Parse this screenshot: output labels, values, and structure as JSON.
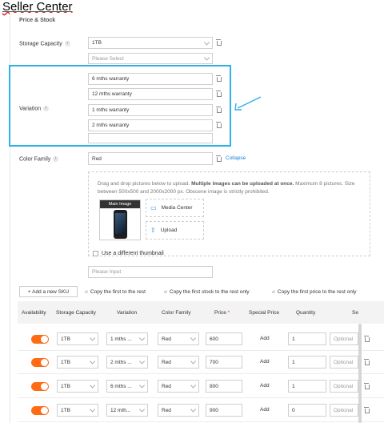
{
  "page_title": "Seller Center",
  "section_title": "Price & Stock",
  "storage_capacity": {
    "label": "Storage Capacity",
    "value": "1TB",
    "placeholder": "Please Select"
  },
  "variation": {
    "label": "Variation",
    "values": [
      "6 mths warranty",
      "12 mths warranty",
      "1 mths warranty",
      "2 mths warranty",
      ""
    ]
  },
  "color_family": {
    "label": "Color Family",
    "value": "Red",
    "collapse_label": "Collapse"
  },
  "upload": {
    "instructions_plain": "Drag and drop pictures below to upload.",
    "instructions_bold": "Multiple images can be uploaded at once.",
    "instructions_rest": "Maximum 8 pictures. Size between 500x500 and 2000x2000 px. Obscene image is strictly prohibited.",
    "main_image_label": "Main Image",
    "media_center_label": "Media Center",
    "upload_label": "Upload",
    "thumbnail_label": "Use a different thumbnail",
    "input_placeholder": "Please Input"
  },
  "actions": {
    "add_sku": "+ Add a new SKU",
    "copy_first_rest": "Copy the first to the rest",
    "copy_stock": "Copy the first stock to the rest only",
    "copy_price": "Copy the first price to the rest only"
  },
  "table": {
    "headers": [
      "Availability",
      "Storage Capacity",
      "Variation",
      "Color Family",
      "Price",
      "*",
      "Special Price",
      "Quantity",
      "Se"
    ],
    "rows": [
      {
        "capacity": "1TB",
        "variation": "1 mths ...",
        "color": "Red",
        "price": "600",
        "special": "Add",
        "quantity": "1",
        "optional": "Optional"
      },
      {
        "capacity": "1TB",
        "variation": "2 mths ...",
        "color": "Red",
        "price": "700",
        "special": "Add",
        "quantity": "1",
        "optional": "Optional"
      },
      {
        "capacity": "1TB",
        "variation": "6 mths ...",
        "color": "Red",
        "price": "800",
        "special": "Add",
        "quantity": "1",
        "optional": "Optional"
      },
      {
        "capacity": "1TB",
        "variation": "12 mth...",
        "color": "Red",
        "price": "900",
        "special": "Add",
        "quantity": "0",
        "optional": "Optional"
      }
    ]
  },
  "colors": {
    "highlight_border": "#2fb1e3",
    "toggle_on": "#ff6a13",
    "link": "#1a7fd8",
    "arrow": "#2fb1e3"
  }
}
